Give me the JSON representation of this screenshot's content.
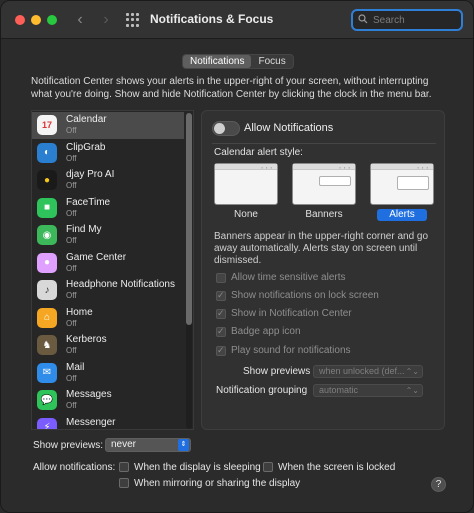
{
  "window": {
    "title": "Notifications & Focus",
    "search_placeholder": "Search"
  },
  "tabs": [
    {
      "label": "Notifications",
      "active": true
    },
    {
      "label": "Focus",
      "active": false
    }
  ],
  "description": "Notification Center shows your alerts in the upper-right of your screen, without interrupting what you're doing. Show and hide Notification Center by clicking the clock in the menu bar.",
  "apps": [
    {
      "name": "Calendar",
      "status": "Off",
      "icon": "calendar-icon",
      "color": "#f4f4f4",
      "selected": true
    },
    {
      "name": "ClipGrab",
      "status": "Off",
      "icon": "clipgrab-icon",
      "color": "#2a7fd0"
    },
    {
      "name": "djay Pro AI",
      "status": "Off",
      "icon": "djay-icon",
      "color": "#1a1a1a"
    },
    {
      "name": "FaceTime",
      "status": "Off",
      "icon": "facetime-icon",
      "color": "#2ec45b"
    },
    {
      "name": "Find My",
      "status": "Off",
      "icon": "findmy-icon",
      "color": "#3cb85a"
    },
    {
      "name": "Game Center",
      "status": "Off",
      "icon": "gamecenter-icon",
      "color": "#e0a0ff"
    },
    {
      "name": "Headphone Notifications",
      "status": "Off",
      "icon": "headphone-icon",
      "color": "#d8d8d8"
    },
    {
      "name": "Home",
      "status": "Off",
      "icon": "home-icon",
      "color": "#f5a623"
    },
    {
      "name": "Kerberos",
      "status": "Off",
      "icon": "kerberos-icon",
      "color": "#6a5a40"
    },
    {
      "name": "Mail",
      "status": "Off",
      "icon": "mail-icon",
      "color": "#2f8ce8"
    },
    {
      "name": "Messages",
      "status": "Off",
      "icon": "messages-icon",
      "color": "#2fc45a"
    },
    {
      "name": "Messenger",
      "status": "Off",
      "icon": "messenger-icon",
      "color": "#7a5cff"
    }
  ],
  "panel": {
    "allow_notifications": "Allow Notifications",
    "allow_enabled": false,
    "alert_style_label": "Calendar alert style:",
    "styles": [
      "None",
      "Banners",
      "Alerts"
    ],
    "selected_style": "Alerts",
    "banner_description": "Banners appear in the upper-right corner and go away automatically. Alerts stay on screen until dismissed.",
    "options": [
      {
        "label": "Allow time sensitive alerts",
        "checked": false
      },
      {
        "label": "Show notifications on lock screen",
        "checked": true
      },
      {
        "label": "Show in Notification Center",
        "checked": true
      },
      {
        "label": "Badge app icon",
        "checked": true
      },
      {
        "label": "Play sound for notifications",
        "checked": true
      }
    ],
    "show_previews_label": "Show previews",
    "show_previews_value": "when unlocked (def...",
    "grouping_label": "Notification grouping",
    "grouping_value": "automatic"
  },
  "bottom": {
    "show_previews_label": "Show previews:",
    "show_previews_value": "never",
    "allow_label": "Allow notifications:",
    "opt_sleeping": "When the display is sleeping",
    "opt_locked": "When the screen is locked",
    "opt_mirroring": "When mirroring or sharing the display",
    "help": "?"
  },
  "colors": {
    "accent": "#1f6fe0",
    "window_bg": "#2b2b2b"
  }
}
